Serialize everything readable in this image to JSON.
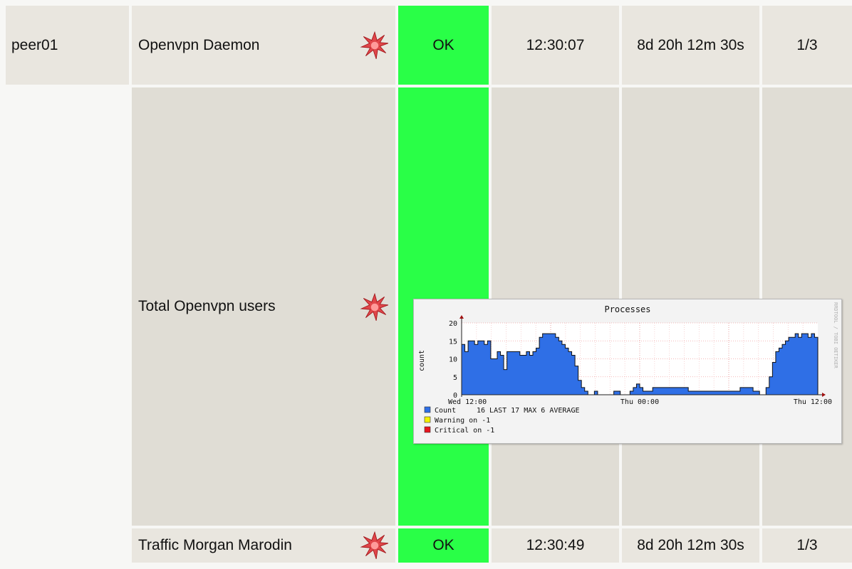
{
  "rows": [
    {
      "host": "peer01",
      "service": "Openvpn Daemon",
      "status": "OK",
      "last_check": "12:30:07",
      "duration": "8d 20h 12m 30s",
      "attempt": "1/3"
    },
    {
      "host": "",
      "service": "Total Openvpn users",
      "status": "",
      "last_check": "",
      "duration": "",
      "attempt": ""
    },
    {
      "host": "",
      "service": "Traffic Morgan Marodin",
      "status": "OK",
      "last_check": "12:30:49",
      "duration": "8d 20h 12m 30s",
      "attempt": "1/3"
    }
  ],
  "icons": {
    "graph_icon": "explosion-star-icon"
  },
  "colors": {
    "status_ok": "#29ff47",
    "series_fill": "#2f6fe6"
  },
  "chart_data": {
    "type": "area",
    "title": "Processes",
    "ylabel": "count",
    "ylim": [
      0,
      20
    ],
    "yticks": [
      "0",
      "5",
      "10",
      "15",
      "20"
    ],
    "xtick_labels": [
      "Wed 12:00",
      "Thu 00:00",
      "Thu 12:00"
    ],
    "watermark": "RRDTOOL / TOBI OETIKER",
    "series": [
      {
        "name": "Count",
        "values": [
          14,
          12,
          15,
          15,
          14,
          15,
          15,
          14,
          15,
          10,
          10,
          12,
          11,
          7,
          12,
          12,
          12,
          12,
          11,
          11,
          12,
          11,
          12,
          13,
          16,
          17,
          17,
          17,
          17,
          16,
          15,
          14,
          13,
          12,
          11,
          8,
          4,
          2,
          1,
          0,
          0,
          1,
          0,
          0,
          0,
          0,
          0,
          1,
          1,
          0,
          0,
          0,
          1,
          2,
          3,
          2,
          1,
          1,
          1,
          2,
          2,
          2,
          2,
          2,
          2,
          2,
          2,
          2,
          2,
          2,
          1,
          1,
          1,
          1,
          1,
          1,
          1,
          1,
          1,
          1,
          1,
          1,
          1,
          1,
          1,
          1,
          2,
          2,
          2,
          2,
          1,
          1,
          0,
          0,
          2,
          5,
          9,
          12,
          13,
          14,
          15,
          16,
          16,
          17,
          16,
          17,
          17,
          16,
          17,
          16
        ]
      }
    ],
    "legend": [
      {
        "label": "Count",
        "text": "16 LAST    17 MAX    6 AVERAGE",
        "color": "#2f6fe6"
      },
      {
        "label": "Warning on -1",
        "text": "",
        "color": "#f4f000"
      },
      {
        "label": "Critical on -1",
        "text": "",
        "color": "#e8141e"
      }
    ]
  }
}
